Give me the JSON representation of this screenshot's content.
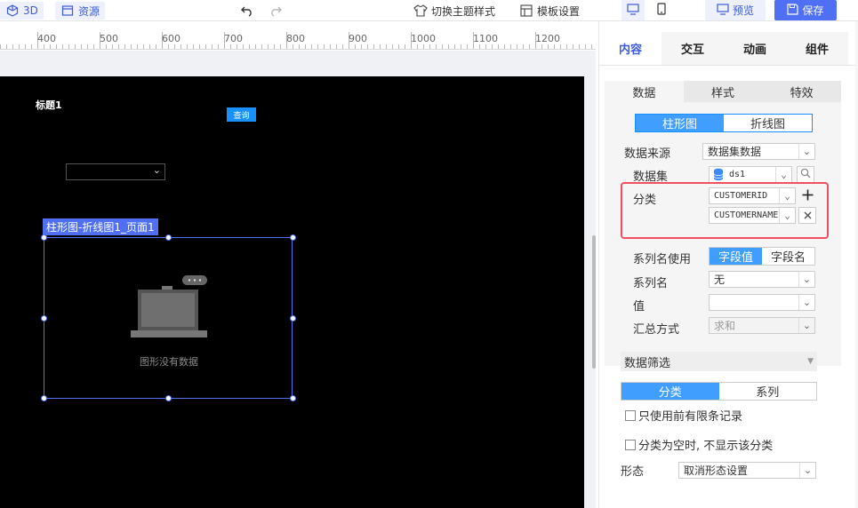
{
  "toolbar": {
    "view_3d_label": "3D",
    "resources_label": "资源",
    "switch_theme_label": "切换主题样式",
    "template_settings_label": "模板设置",
    "preview_label": "预览",
    "save_label": "保存"
  },
  "ruler": {
    "labels": [
      "400",
      "500",
      "600",
      "700",
      "800",
      "900",
      "1000",
      "1100",
      "1200"
    ]
  },
  "canvas": {
    "title": "标题1",
    "query_button": "查询",
    "select_value": "",
    "chart_tag": "柱形图-折线图1_页面1",
    "no_data_text": "图形没有数据"
  },
  "panel": {
    "main_tabs": [
      "内容",
      "交互",
      "动画",
      "组件"
    ],
    "active_main_tab": "内容",
    "sub_tabs": [
      "数据",
      "样式",
      "特效"
    ],
    "active_sub_tab": "数据",
    "chart_types": [
      "柱形图",
      "折线图"
    ],
    "active_chart_type": "柱形图",
    "data_source_label": "数据来源",
    "data_source_value": "数据集数据",
    "dataset_label": "数据集",
    "dataset_value": "ds1",
    "category_label": "分类",
    "category_fields": [
      "CUSTOMERID",
      "CUSTOMERNAME"
    ],
    "series_name_use_label": "系列名使用",
    "series_name_use_options": [
      "字段值",
      "字段名"
    ],
    "active_series_name_use": "字段值",
    "series_name_label": "系列名",
    "series_name_value": "无",
    "value_label": "值",
    "value_value": "",
    "summary_label": "汇总方式",
    "summary_value": "求和",
    "filter_section_label": "数据筛选",
    "filter_tabs": [
      "分类",
      "系列"
    ],
    "active_filter_tab": "分类",
    "only_first_label": "只使用前有限条记录",
    "hide_empty_label": "分类为空时, 不显示该分类",
    "form_label": "形态",
    "form_value": "取消形态设置"
  },
  "colors": {
    "accent": "#4f6ff5",
    "segment_active": "#409eff",
    "highlight": "#ef4f5f",
    "canvas_bg": "#000000"
  }
}
